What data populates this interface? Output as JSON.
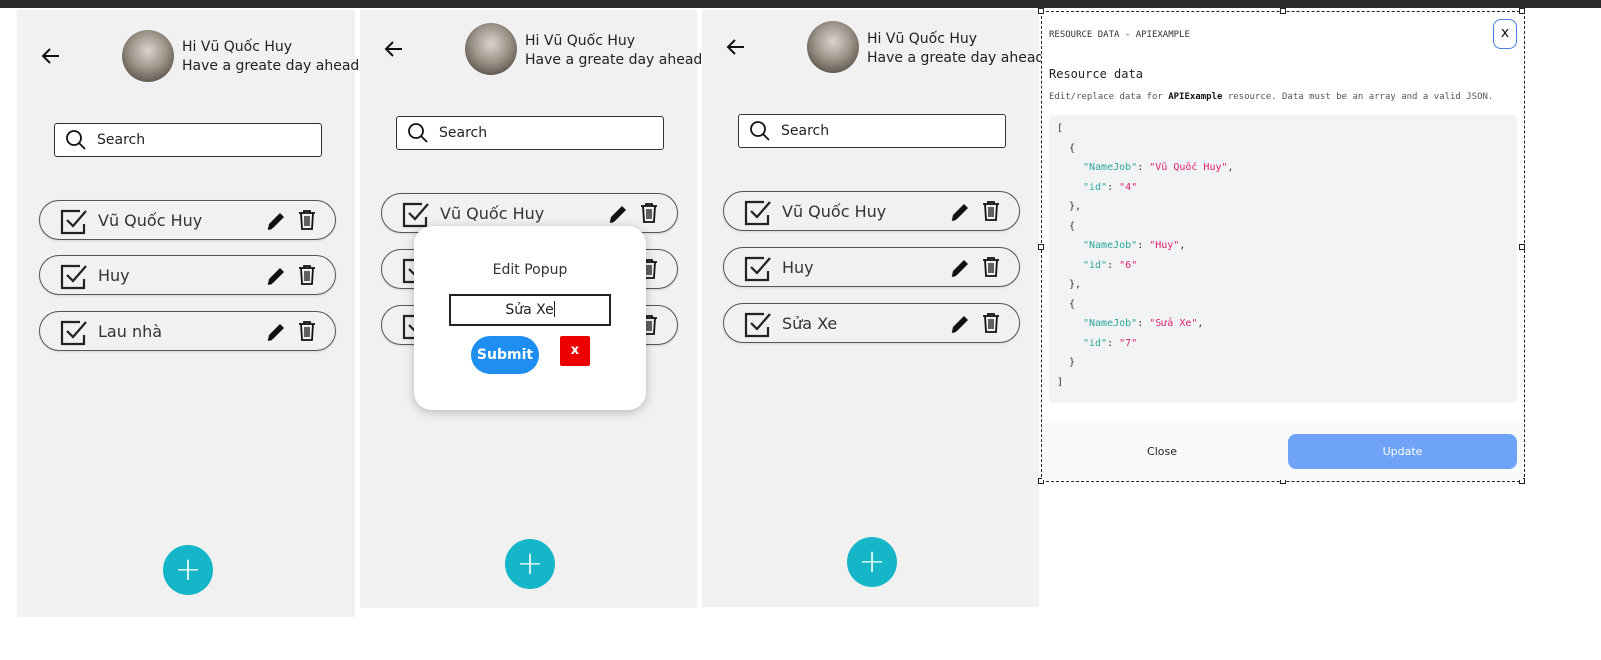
{
  "screens": [
    {
      "greeting": "Hi Vũ Quốc Huy",
      "subgreeting": "Have a greate day ahead",
      "search_placeholder": "Search",
      "items": [
        "Vũ Quốc Huy",
        "Huy",
        "Lau nhà"
      ]
    },
    {
      "greeting": "Hi Vũ Quốc Huy",
      "subgreeting": "Have a greate day ahead",
      "search_placeholder": "Search",
      "items": [
        "Vũ Quốc Huy",
        "",
        ""
      ]
    },
    {
      "greeting": "Hi Vũ Quốc Huy",
      "subgreeting": "Have a greate day ahead",
      "search_placeholder": "Search",
      "items": [
        "Vũ Quốc Huy",
        "Huy",
        "Sửa Xe"
      ]
    }
  ],
  "fab_icon": "+",
  "popup": {
    "title": "Edit Popup",
    "input_value": "Sửa Xe",
    "submit_label": "Submit",
    "close_label": "x"
  },
  "resource_dialog": {
    "title": "RESOURCE DATA - APIEXAMPLE",
    "close_icon": "x",
    "heading": "Resource data",
    "desc_before": "Edit/replace data for ",
    "desc_resource": "APIExample",
    "desc_after": " resource. Data must be an array and a valid JSON.",
    "records": [
      {
        "NameJob": "Vũ Quốc Huy",
        "id": "4"
      },
      {
        "NameJob": "Huy",
        "id": "6"
      },
      {
        "NameJob": "Sửa Xe",
        "id": "7"
      }
    ],
    "close_button": "Close",
    "update_button": "Update"
  },
  "colors": {
    "fab": "#14b6c7",
    "submit": "#1f8ef1",
    "popup_close": "#ee0000",
    "update_button": "#6ea3f7",
    "json_key": "#2aa59b",
    "json_value": "#e0206a"
  },
  "icons": [
    "arrow-left-icon",
    "avatar",
    "search-icon",
    "checkbox-icon",
    "pencil-icon",
    "trash-icon",
    "plus-icon",
    "close-icon"
  ]
}
